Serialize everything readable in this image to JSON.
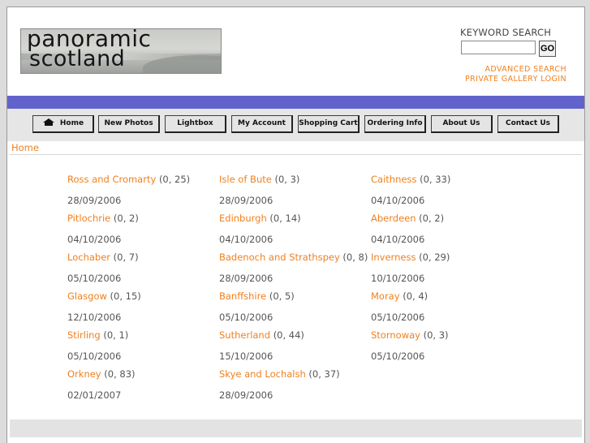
{
  "header": {
    "logo_line1": "panoramic",
    "logo_line2": "scotland",
    "keyword_label": "KEYWORD SEARCH",
    "keyword_value": "",
    "go_label": "GO",
    "advanced_search": "ADVANCED SEARCH",
    "private_gallery": "PRIVATE GALLERY LOGIN"
  },
  "nav": {
    "items": [
      "Home",
      "New Photos",
      "Lightbox",
      "My Account",
      "Shopping Cart",
      "Ordering Info",
      "About Us",
      "Contact Us"
    ]
  },
  "breadcrumb": {
    "home": "Home"
  },
  "galleries": [
    [
      {
        "name": "Ross and Cromarty",
        "count": "(0, 25)",
        "date": "28/09/2006"
      },
      {
        "name": "Pitlochrie",
        "count": "(0, 2)",
        "date": "04/10/2006"
      },
      {
        "name": "Lochaber",
        "count": "(0, 7)",
        "date": "05/10/2006"
      },
      {
        "name": "Glasgow",
        "count": "(0, 15)",
        "date": "12/10/2006"
      },
      {
        "name": "Stirling",
        "count": "(0, 1)",
        "date": "05/10/2006"
      },
      {
        "name": "Orkney",
        "count": "(0, 83)",
        "date": "02/01/2007"
      }
    ],
    [
      {
        "name": "Isle of Bute",
        "count": "(0, 3)",
        "date": "28/09/2006"
      },
      {
        "name": "Edinburgh",
        "count": "(0, 14)",
        "date": "04/10/2006"
      },
      {
        "name": "Badenoch and Strathspey",
        "count": "(0, 8)",
        "date": "28/09/2006"
      },
      {
        "name": "Banffshire",
        "count": "(0, 5)",
        "date": "05/10/2006"
      },
      {
        "name": "Sutherland",
        "count": "(0, 44)",
        "date": "15/10/2006"
      },
      {
        "name": "Skye and Lochalsh",
        "count": "(0, 37)",
        "date": "28/09/2006"
      }
    ],
    [
      {
        "name": "Caithness",
        "count": "(0, 33)",
        "date": "04/10/2006"
      },
      {
        "name": "Aberdeen",
        "count": "(0, 2)",
        "date": "04/10/2006"
      },
      {
        "name": "Inverness",
        "count": "(0, 29)",
        "date": "10/10/2006"
      },
      {
        "name": "Moray",
        "count": "(0, 4)",
        "date": "05/10/2006"
      },
      {
        "name": "Stornoway",
        "count": "(0, 3)",
        "date": "05/10/2006"
      }
    ]
  ],
  "colors": {
    "link": "#f0801f",
    "bar": "#6262cc",
    "text": "#555555"
  },
  "icons": {
    "home_button": "home-icon"
  }
}
